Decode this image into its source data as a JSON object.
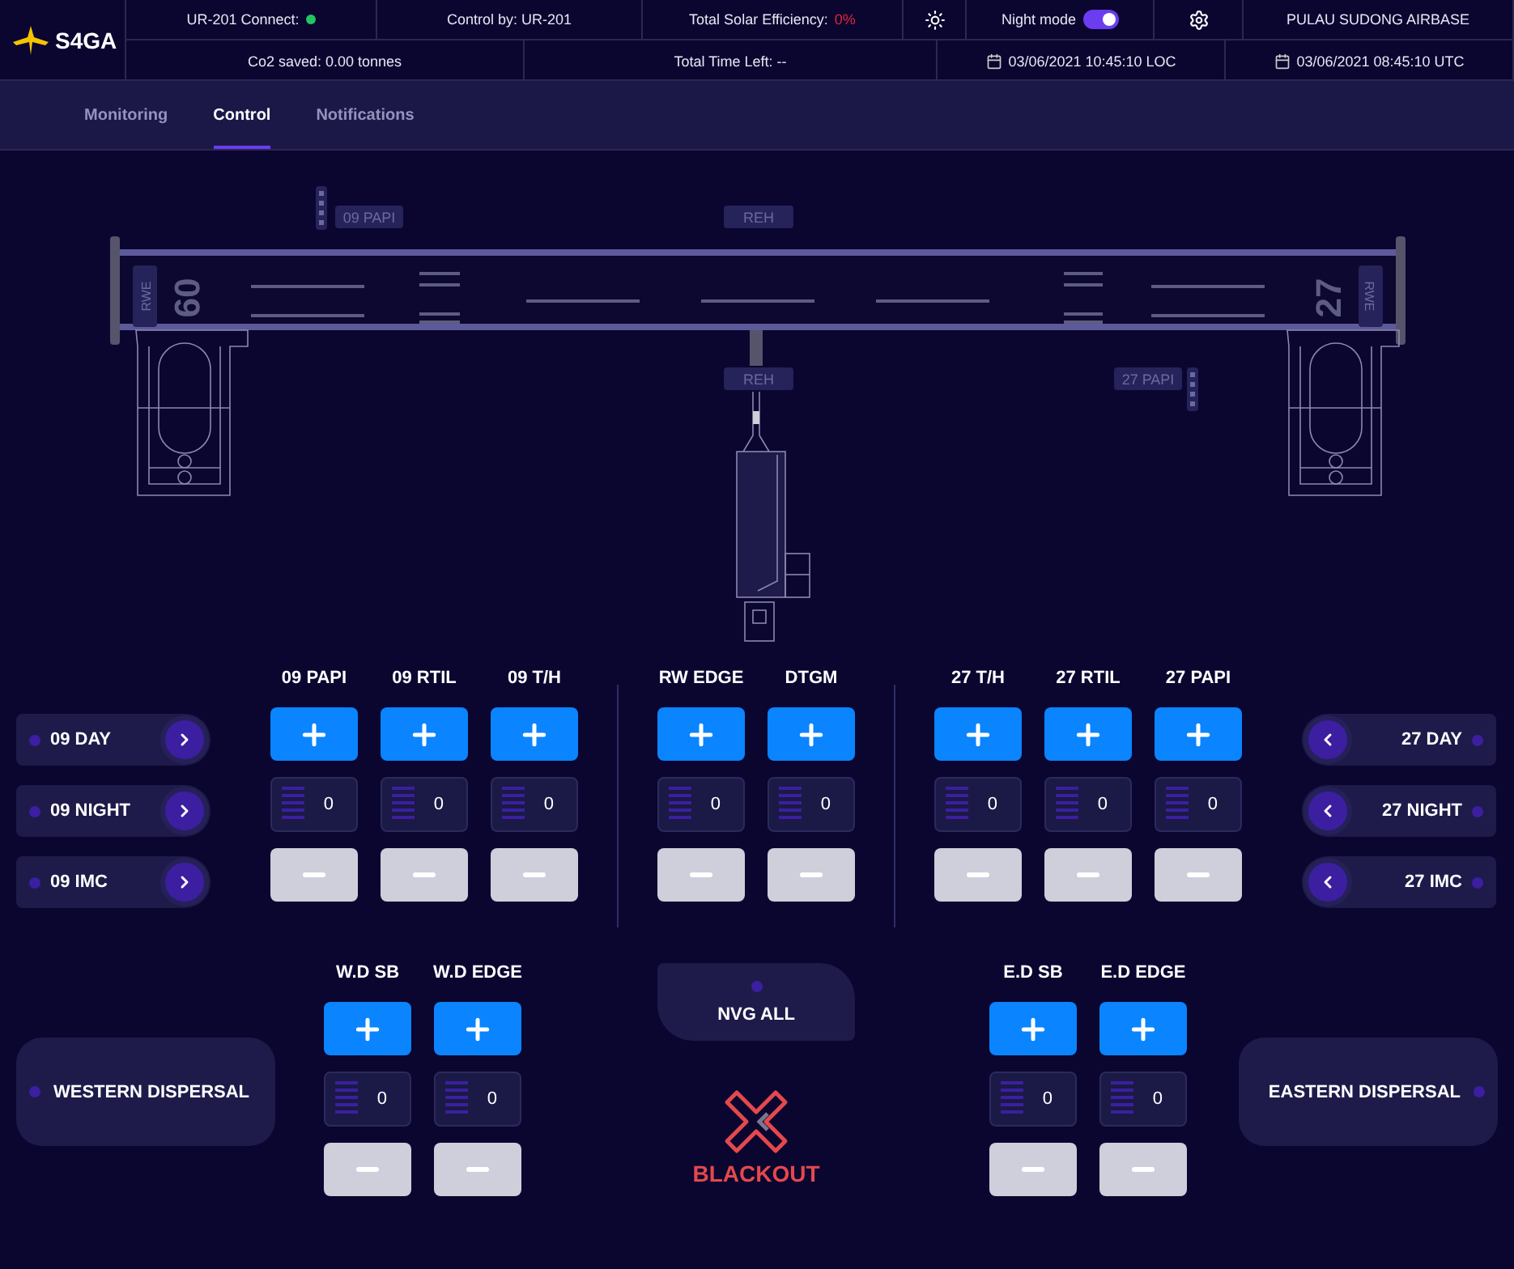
{
  "header": {
    "logo": "S4GA",
    "connect": {
      "label": "UR-201 Connect:",
      "connected": true
    },
    "control_by": "Control by: UR-201",
    "solar": {
      "label": "Total Solar Efficiency:",
      "value": "0%"
    },
    "night_mode": {
      "label": "Night mode",
      "on": true
    },
    "airbase": "PULAU SUDONG AIRBASE",
    "co2": "Co2 saved: 0.00 tonnes",
    "time_left": "Total Time Left: --",
    "local_time": "03/06/2021 10:45:10 LOC",
    "utc_time": "03/06/2021 08:45:10 UTC"
  },
  "tabs": [
    {
      "label": "Monitoring",
      "selected": false
    },
    {
      "label": "Control",
      "selected": true
    },
    {
      "label": "Notifications",
      "selected": false
    }
  ],
  "diagram": {
    "papi_west": "09 PAPI",
    "reh_top": "REH",
    "reh_bottom": "REH",
    "papi_east": "27 PAPI",
    "rwe_west": "RWE",
    "rwe_east": "RWE",
    "threshold_west": "09",
    "threshold_east": "27"
  },
  "left_modes": [
    {
      "label": "09 DAY",
      "on": false
    },
    {
      "label": "09 NIGHT",
      "on": false
    },
    {
      "label": "09 IMC",
      "on": false
    }
  ],
  "channel_groups": [
    [
      {
        "name": "09 PAPI",
        "value": "0"
      },
      {
        "name": "09 RTIL",
        "value": "0"
      },
      {
        "name": "09 T/H",
        "value": "0"
      }
    ],
    [
      {
        "name": "RW EDGE",
        "value": "0"
      },
      {
        "name": "DTGM",
        "value": "0"
      }
    ],
    [
      {
        "name": "27 T/H",
        "value": "0"
      },
      {
        "name": "27 RTIL",
        "value": "0"
      },
      {
        "name": "27 PAPI",
        "value": "0"
      }
    ]
  ],
  "right_modes": [
    {
      "label": "27 DAY",
      "on": false
    },
    {
      "label": "27 NIGHT",
      "on": false
    },
    {
      "label": "27 IMC",
      "on": false
    }
  ],
  "western_dispersal": {
    "label": "WESTERN DISPERSAL",
    "on": false
  },
  "western_channels": [
    {
      "name": "W.D SB",
      "value": "0"
    },
    {
      "name": "W.D EDGE",
      "value": "0"
    }
  ],
  "nvg": {
    "label": "NVG ALL",
    "on": false
  },
  "blackout": {
    "label": "BLACKOUT"
  },
  "eastern_channels": [
    {
      "name": "E.D SB",
      "value": "0"
    },
    {
      "name": "E.D EDGE",
      "value": "0"
    }
  ],
  "eastern_dispersal": {
    "label": "EASTERN DISPERSAL",
    "on": false
  }
}
